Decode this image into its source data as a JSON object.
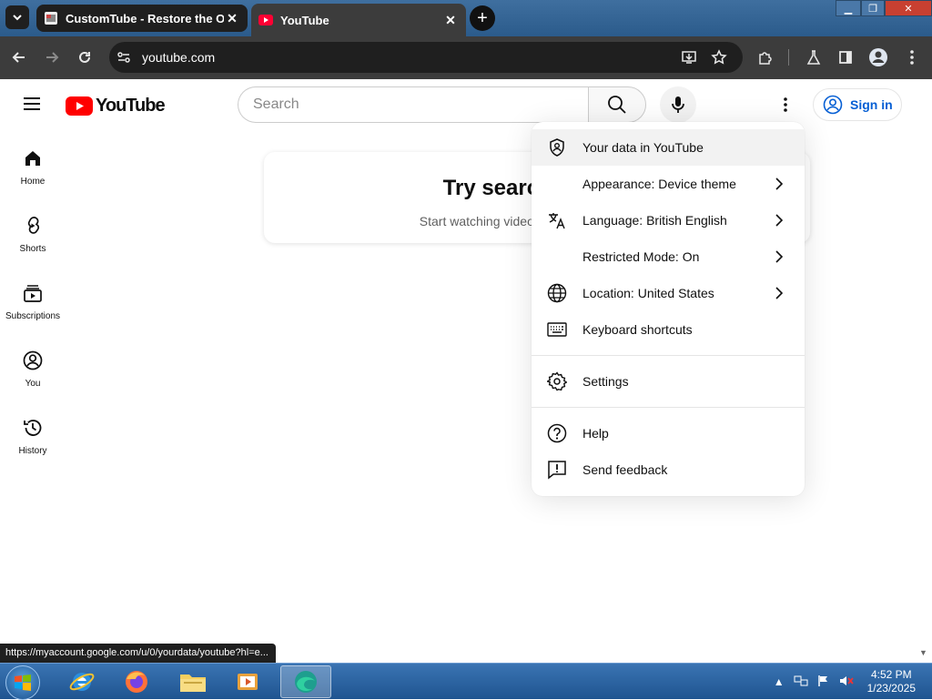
{
  "browser": {
    "tabs": [
      {
        "title": "CustomTube - Restore the Old",
        "active": false
      },
      {
        "title": "YouTube",
        "active": true
      }
    ],
    "url": "youtube.com",
    "status_url": "https://myaccount.google.com/u/0/yourdata/youtube?hl=e..."
  },
  "youtube": {
    "logo_text": "YouTube",
    "search_placeholder": "Search",
    "sign_in": "Sign in",
    "guide": [
      {
        "label": "Home",
        "icon": "home-icon"
      },
      {
        "label": "Shorts",
        "icon": "shorts-icon"
      },
      {
        "label": "Subscriptions",
        "icon": "subscriptions-icon"
      },
      {
        "label": "You",
        "icon": "you-icon"
      },
      {
        "label": "History",
        "icon": "history-icon"
      }
    ],
    "prompt": {
      "title": "Try searching to g",
      "subtitle": "Start watching videos to help us build a fe"
    },
    "menu": {
      "items": [
        {
          "label": "Your data in YouTube",
          "icon": "shield-person-icon"
        },
        {
          "label": "Appearance: Device theme",
          "icon": "",
          "submenu": true
        },
        {
          "label": "Language: British English",
          "icon": "translate-icon",
          "submenu": true
        },
        {
          "label": "Restricted Mode: On",
          "icon": "",
          "submenu": true
        },
        {
          "label": "Location: United States",
          "icon": "globe-icon",
          "submenu": true
        },
        {
          "label": "Keyboard shortcuts",
          "icon": "keyboard-icon"
        },
        {
          "label": "Settings",
          "icon": "settings-gear-icon"
        },
        {
          "label": "Help",
          "icon": "help-icon"
        },
        {
          "label": "Send feedback",
          "icon": "feedback-icon"
        }
      ]
    }
  },
  "taskbar": {
    "time": "4:52 PM",
    "date": "1/23/2025"
  },
  "colors": {
    "youtube_red": "#ff0000",
    "link_blue": "#065fd4",
    "chrome_dark": "#3c3c3c"
  }
}
